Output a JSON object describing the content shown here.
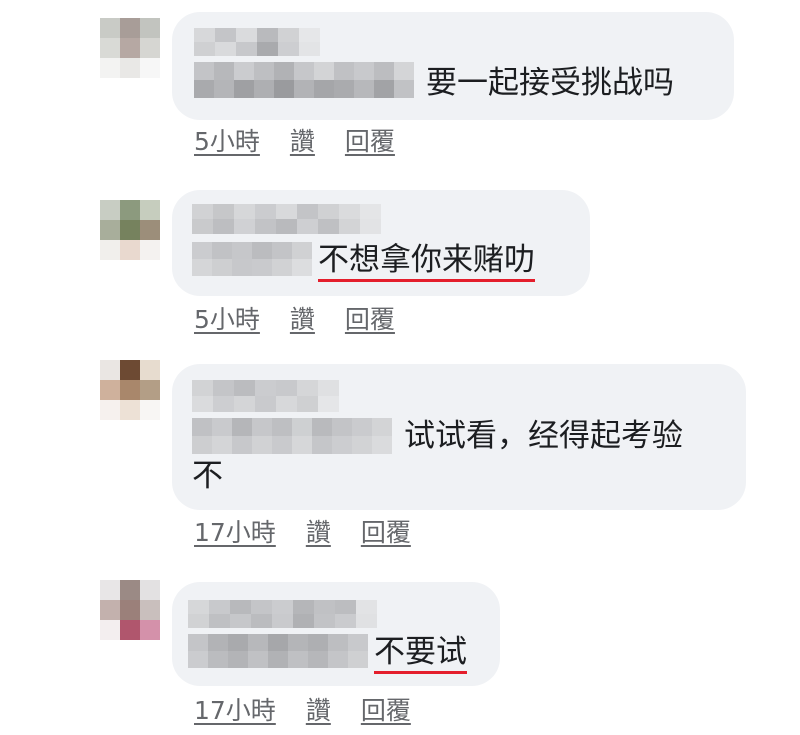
{
  "comments": [
    {
      "text": "要一起接受挑战吗",
      "time": "5小時",
      "like": "讚",
      "reply": "回覆",
      "highlight": false
    },
    {
      "text": "不想拿你来赌叻",
      "time": "5小時",
      "like": "讚",
      "reply": "回覆",
      "highlight": true
    },
    {
      "text": "试试看，经得起考验",
      "text_line2": "不",
      "time": "17小時",
      "like": "讚",
      "reply": "回覆",
      "highlight": false
    },
    {
      "text": "不要试",
      "time": "17小時",
      "like": "讚",
      "reply": "回覆",
      "highlight": true
    }
  ],
  "colors": {
    "bubble": "#f0f2f5",
    "meta_text": "#65676b",
    "highlight_underline": "#e41e2c"
  },
  "icons": {
    "avatar": "pixelated-avatar",
    "name": "pixelated-name-blur"
  }
}
